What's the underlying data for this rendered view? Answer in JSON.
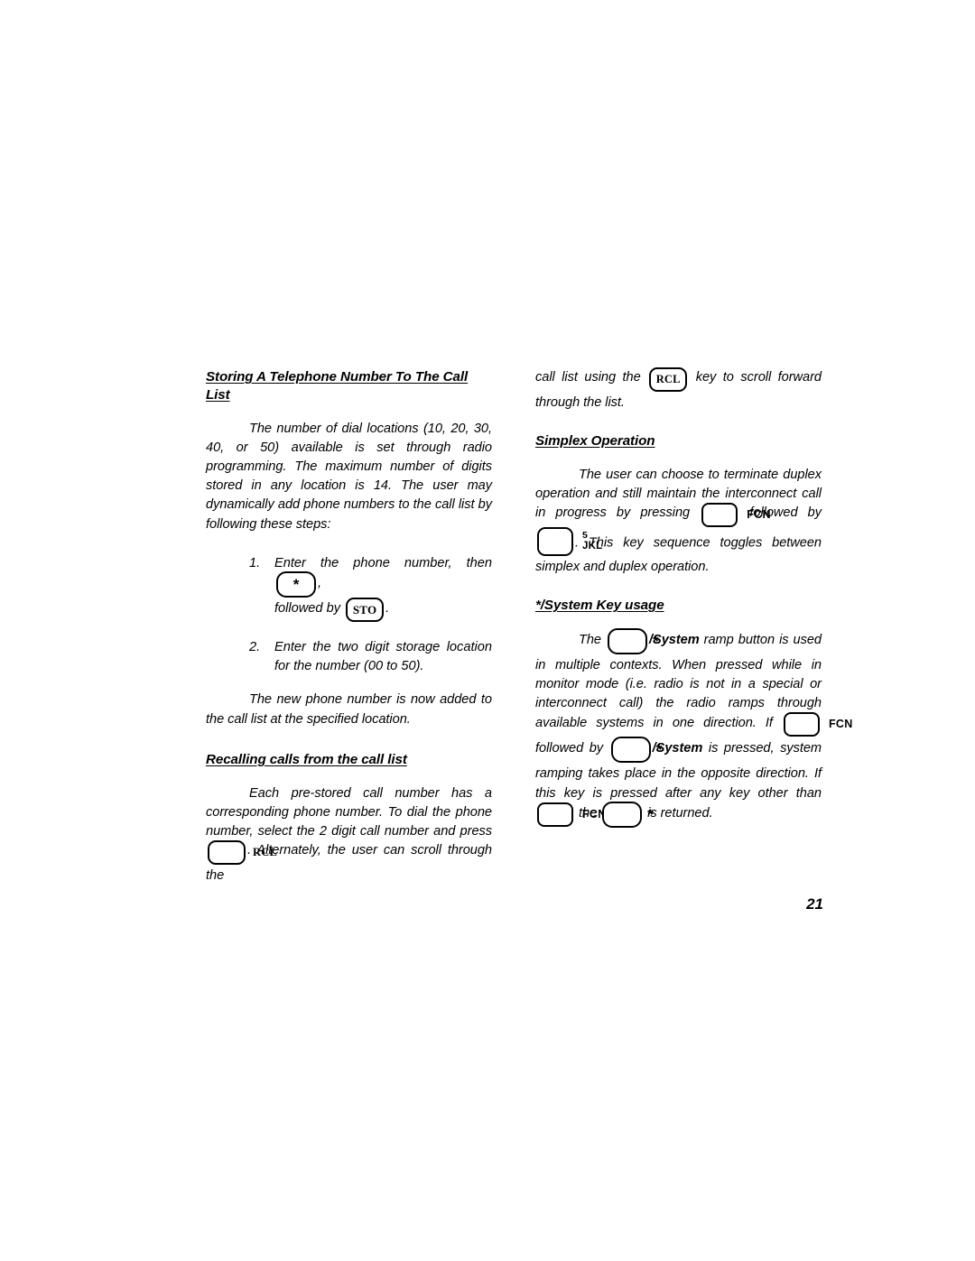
{
  "page": {
    "number": "21",
    "background_color": "#ffffff",
    "text_color": "#000000"
  },
  "left_column": {
    "heading_1": "Storing A Telephone Number To The Call List",
    "paragraph_1": "The number of dial locations (10, 20, 30, 40, or 50) available is set through radio programming. The maximum number of digits stored in any location is 14.  The user may dynamically add phone numbers to the call list by following these steps:",
    "steps": [
      {
        "number": "1.",
        "text_before_key": "Enter the phone number, then ",
        "key_1": "*",
        "text_after_key": ",",
        "line2_before_key": "followed by ",
        "key_2": "STO",
        "line2_after_key": "."
      },
      {
        "number": "2.",
        "text": "Enter the two digit storage location for the number (00 to 50)."
      }
    ],
    "paragraph_2": "The new phone number is now added to the call list at the specified location.",
    "heading_2": "Recalling calls from the call list",
    "paragraph_3_part1": "Each pre-stored call number has a corresponding phone number.  To dial the phone number, select the 2 digit call number and press ",
    "paragraph_3_key": "RCL",
    "paragraph_3_part2": ".  Alternately, the user can scroll through the"
  },
  "right_column": {
    "paragraph_1_part1": "call list using the ",
    "paragraph_1_key": "RCL",
    "paragraph_1_part2": " key to scroll forward through the list.",
    "heading_1": "Simplex Operation",
    "paragraph_2_part1": "The user can choose to terminate duplex operation and still maintain the interconnect call in progress by pressing ",
    "paragraph_2_key_1": "FCN",
    "paragraph_2_mid": " followed by ",
    "paragraph_2_key_2_top": "5",
    "paragraph_2_key_2_bottom": "JKL",
    "paragraph_2_part2": ".  This key sequence toggles between simplex and duplex operation.",
    "heading_2": "*/System Key usage",
    "paragraph_3_part1": "The ",
    "paragraph_3_key_1": "*",
    "paragraph_3_bold_1": "/System",
    "paragraph_3_part2": " ramp button is used in multiple contexts.  When pressed while in monitor mode (i.e. radio is not in a special or interconnect call) the radio ramps through available systems in one direction.  If ",
    "paragraph_3_key_2": "FCN",
    "paragraph_3_part3": " followed by ",
    "paragraph_3_key_3": "*",
    "paragraph_3_bold_2": "/System",
    "paragraph_3_part4": " is pressed, system ramping takes place in the opposite direction.  If this key is pressed after any key other than ",
    "paragraph_3_key_4": "FCN",
    "paragraph_3_part5": " the ",
    "paragraph_3_key_5": "*",
    "paragraph_3_part6": " is returned."
  }
}
